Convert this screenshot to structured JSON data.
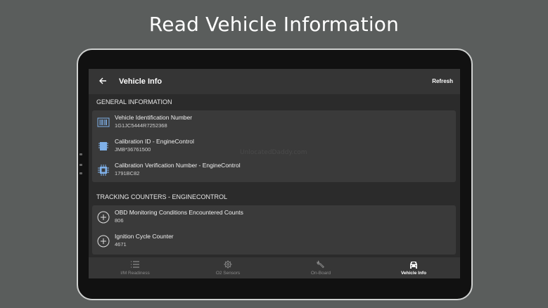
{
  "headline": "Read Vehicle Information",
  "appbar": {
    "title": "Vehicle Info",
    "refresh_label": "Refresh"
  },
  "watermark": "UnlocatedDaddy.com",
  "general": {
    "header": "GENERAL INFORMATION",
    "rows": [
      {
        "label": "Vehicle Identification Number",
        "value": "1G1JC5444R7252368",
        "icon": "barcode-icon"
      },
      {
        "label": "Calibration ID - EngineControl",
        "value": "JMB*36761500",
        "icon": "chip-icon"
      },
      {
        "label": "Calibration Verification Number - EngineControl",
        "value": "1791BC82",
        "icon": "chip-icon"
      }
    ]
  },
  "tracking": {
    "header": "TRACKING COUNTERS - ENGINECONTROL",
    "rows": [
      {
        "label": "OBD Monitoring Conditions Encountered Counts",
        "value": "806",
        "icon": "plus-circle-icon"
      },
      {
        "label": "Ignition Cycle Counter",
        "value": "4671",
        "icon": "plus-circle-icon"
      }
    ]
  },
  "nav": [
    {
      "label": "I/M Readiness",
      "icon": "list-icon",
      "active": false
    },
    {
      "label": "O2 Sensors",
      "icon": "gear-icon",
      "active": false
    },
    {
      "label": "On-Board",
      "icon": "wrench-icon",
      "active": false
    },
    {
      "label": "Vehicle Info",
      "icon": "car-icon",
      "active": true
    }
  ],
  "colors": {
    "background": "#5a5d5c",
    "screen": "#2b2b2b",
    "card": "#3a3a3a",
    "appbar": "#353535"
  }
}
